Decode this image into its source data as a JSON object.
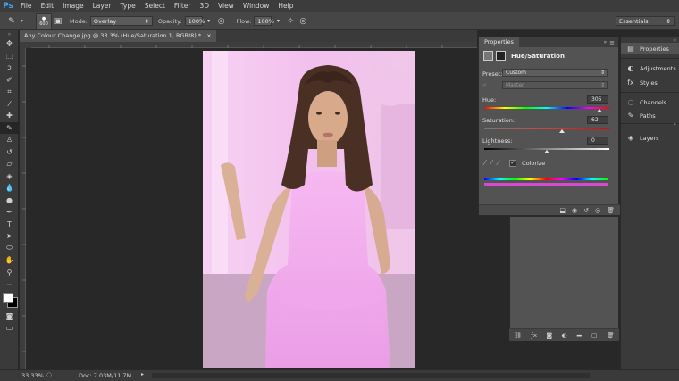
{
  "menubar": {
    "logo": "Ps",
    "items": [
      "File",
      "Edit",
      "Image",
      "Layer",
      "Type",
      "Select",
      "Filter",
      "3D",
      "View",
      "Window",
      "Help"
    ]
  },
  "options": {
    "brush_size": "600",
    "mode_label": "Mode:",
    "mode_value": "Overlay",
    "opacity_label": "Opacity:",
    "opacity_value": "100%",
    "flow_label": "Flow:",
    "flow_value": "100%",
    "workspace": "Essentials"
  },
  "document": {
    "tab_title": "Any Colour Change.jpg @ 33.3% (Hue/Saturation 1, RGB/8) *",
    "close_glyph": "×"
  },
  "status": {
    "zoom": "33.33%",
    "doc": "Doc: 7.03M/11.7M"
  },
  "properties": {
    "tab": "Properties",
    "title": "Hue/Saturation",
    "preset_label": "Preset:",
    "preset_value": "Custom",
    "channel_value": "Master",
    "hue_label": "Hue:",
    "hue_value": "305",
    "hue_level": 0.92,
    "saturation_label": "Saturation:",
    "saturation_value": "62",
    "saturation_level": 0.62,
    "lightness_label": "Lightness:",
    "lightness_value": "0",
    "lightness_level": 0.5,
    "colorize_label": "Colorize",
    "colorize_checked": true
  },
  "dock": {
    "properties": "Properties",
    "adjustments": "Adjustments",
    "styles": "Styles",
    "channels": "Channels",
    "paths": "Paths",
    "layers": "Layers"
  },
  "colors": {
    "accent": "#3fa9f5",
    "tint": "#f2b8ef"
  }
}
